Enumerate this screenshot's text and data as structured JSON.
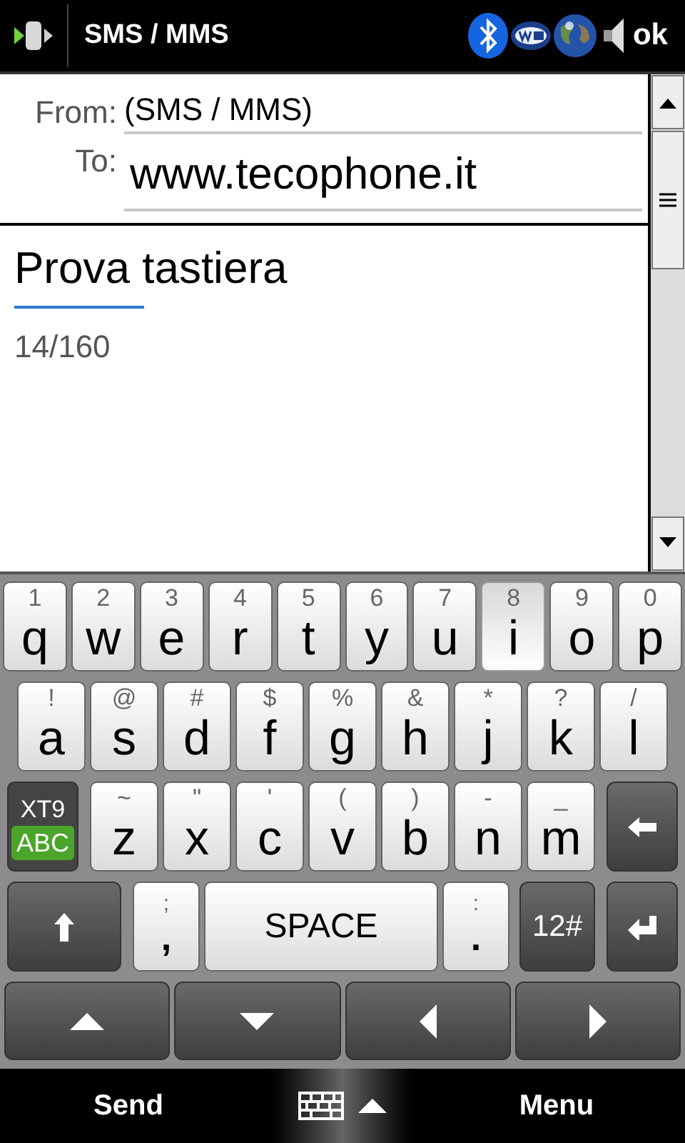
{
  "title_bar": {
    "title": "SMS / MMS",
    "ok": "ok"
  },
  "header": {
    "from_label": "From:",
    "from_value": "(SMS / MMS)",
    "to_label": "To:",
    "to_value": "www.tecophone.it"
  },
  "message": {
    "text": "Prova tastiera",
    "counter": "14/160"
  },
  "keyboard": {
    "top_row": [
      {
        "kind": "letter",
        "alt": "1",
        "main": "q",
        "selected": false
      },
      {
        "kind": "letter",
        "alt": "2",
        "main": "w",
        "selected": false
      },
      {
        "kind": "letter",
        "alt": "3",
        "main": "e",
        "selected": false
      },
      {
        "kind": "letter",
        "alt": "4",
        "main": "r",
        "selected": false
      },
      {
        "kind": "letter",
        "alt": "5",
        "main": "t",
        "selected": false
      },
      {
        "kind": "letter",
        "alt": "6",
        "main": "y",
        "selected": false
      },
      {
        "kind": "letter",
        "alt": "7",
        "main": "u",
        "selected": false
      },
      {
        "kind": "letter",
        "alt": "8",
        "main": "i",
        "selected": true
      },
      {
        "kind": "letter",
        "alt": "9",
        "main": "o",
        "selected": false
      },
      {
        "kind": "letter",
        "alt": "0",
        "main": "p",
        "selected": false
      }
    ],
    "home_row": [
      {
        "kind": "letter",
        "alt": "!",
        "main": "a",
        "selected": false
      },
      {
        "kind": "letter",
        "alt": "@",
        "main": "s",
        "selected": false
      },
      {
        "kind": "letter",
        "alt": "#",
        "main": "d",
        "selected": false
      },
      {
        "kind": "letter",
        "alt": "$",
        "main": "f",
        "selected": false
      },
      {
        "kind": "letter",
        "alt": "%",
        "main": "g",
        "selected": false
      },
      {
        "kind": "letter",
        "alt": "&",
        "main": "h",
        "selected": false
      },
      {
        "kind": "letter",
        "alt": "*",
        "main": "j",
        "selected": false
      },
      {
        "kind": "letter",
        "alt": "?",
        "main": "k",
        "selected": false
      },
      {
        "kind": "letter",
        "alt": "/",
        "main": "l",
        "selected": false
      }
    ],
    "bottom_letter_row": [
      {
        "kind": "mode",
        "top": "XT9",
        "bottom": "ABC"
      },
      {
        "kind": "letter",
        "alt": "~",
        "main": "z",
        "selected": false
      },
      {
        "kind": "letter",
        "alt": "\"",
        "main": "x",
        "selected": false
      },
      {
        "kind": "letter",
        "alt": "'",
        "main": "c",
        "selected": false
      },
      {
        "kind": "letter",
        "alt": "(",
        "main": "v",
        "selected": false
      },
      {
        "kind": "letter",
        "alt": ")",
        "main": "b",
        "selected": false
      },
      {
        "kind": "letter",
        "alt": "-",
        "main": "n",
        "selected": false
      },
      {
        "kind": "letter",
        "alt": "_",
        "main": "m",
        "selected": false
      },
      {
        "kind": "backspace"
      }
    ],
    "space_row": [
      {
        "kind": "shift"
      },
      {
        "kind": "punct",
        "alt": ";",
        "main": ","
      },
      {
        "kind": "label",
        "label": "SPACE"
      },
      {
        "kind": "punct",
        "alt": ":",
        "main": "."
      },
      {
        "kind": "dark",
        "label": "12#"
      },
      {
        "kind": "enter"
      }
    ],
    "arrow_row": [
      {
        "kind": "up"
      },
      {
        "kind": "down"
      },
      {
        "kind": "left"
      },
      {
        "kind": "right"
      }
    ]
  },
  "soft_keys": {
    "left": "Send",
    "right": "Menu"
  }
}
